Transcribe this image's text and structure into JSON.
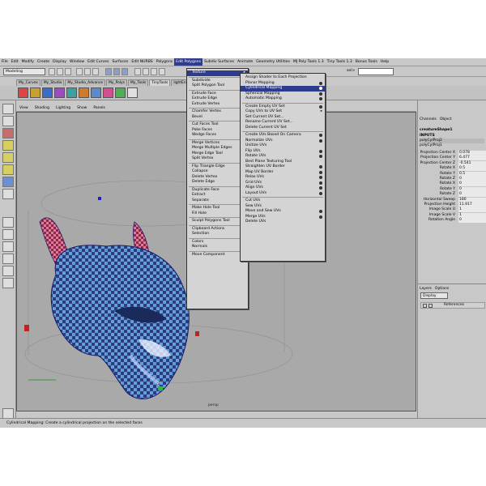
{
  "menubar": [
    "File",
    "Edit",
    "Modify",
    "Create",
    "Display",
    "Window",
    "Edit Curves",
    "Surfaces",
    "Edit NURBS",
    "Polygons",
    "Edit Polygons",
    "Subdiv Surfaces",
    "Animate",
    "Geometry Utilities",
    "MJ Poly Tools 1.3",
    "Tiny Tools 1.3",
    "Bonus Tools",
    "Help"
  ],
  "status": {
    "mode": "Modeling",
    "sel_label": "sel>"
  },
  "shelf_tabs": [
    "My_Curves",
    "My_Studio",
    "My_Studio_Advance",
    "My_Polys",
    "My_Tools",
    "TinyTools",
    "lightEnv"
  ],
  "panel_menu": [
    "View",
    "Shading",
    "Lighting",
    "Show",
    "Panels"
  ],
  "viewport": {
    "camera": "persp"
  },
  "help_line": "Cylindrical Mapping: Create a cylindrical projection on the selected faces",
  "edit_polygons_menu": {
    "items": [
      {
        "label": "Texture",
        "arrow": "▸",
        "hl": true
      },
      {
        "sep": true
      },
      {
        "label": "Subdivide",
        "opt": true
      },
      {
        "label": "Split Polygon Tool",
        "opt": true
      },
      {
        "sep": true
      },
      {
        "label": "Extrude Face",
        "opt": true
      },
      {
        "label": "Extrude Edge",
        "opt": true
      },
      {
        "label": "Extrude Vertex",
        "opt": true
      },
      {
        "sep": true
      },
      {
        "label": "Chamfer Vertex",
        "opt": true
      },
      {
        "label": "Bevel",
        "opt": true
      },
      {
        "sep": true
      },
      {
        "label": "Cut Faces Tool",
        "opt": true
      },
      {
        "label": "Poke Faces",
        "opt": true
      },
      {
        "label": "Wedge Faces",
        "opt": true
      },
      {
        "sep": true
      },
      {
        "label": "Merge Vertices",
        "opt": true
      },
      {
        "label": "Merge Multiple Edges",
        "opt": true
      },
      {
        "label": "Merge Edge Tool",
        "opt": true
      },
      {
        "label": "Split Vertex"
      },
      {
        "sep": true
      },
      {
        "label": "Flip Triangle Edge"
      },
      {
        "label": "Collapse"
      },
      {
        "label": "Delete Vertex"
      },
      {
        "label": "Delete Edge"
      },
      {
        "sep": true
      },
      {
        "label": "Duplicate Face",
        "opt": true
      },
      {
        "label": "Extract",
        "opt": true
      },
      {
        "label": "Separate"
      },
      {
        "sep": true
      },
      {
        "label": "Make Hole Tool",
        "opt": true
      },
      {
        "label": "Fill Hole"
      },
      {
        "sep": true
      },
      {
        "label": "Sculpt Polygons Tool",
        "opt": true
      },
      {
        "sep": true
      },
      {
        "label": "Clipboard Actions",
        "arrow": "▸"
      },
      {
        "label": "Selection",
        "arrow": "▸"
      },
      {
        "sep": true
      },
      {
        "label": "Colors",
        "arrow": "▸"
      },
      {
        "label": "Normals",
        "arrow": "▸"
      },
      {
        "sep": true
      },
      {
        "label": "Move Component",
        "opt": true
      }
    ]
  },
  "texture_submenu": {
    "items": [
      {
        "label": "Assign Shader to Each Projection"
      },
      {
        "label": "Planar Mapping",
        "opt": true
      },
      {
        "label": "Cylindrical Mapping",
        "opt": true,
        "hl": true
      },
      {
        "label": "Spherical Mapping",
        "opt": true
      },
      {
        "label": "Automatic Mapping",
        "opt": true
      },
      {
        "sep": true
      },
      {
        "label": "Create Empty UV Set",
        "opt": true
      },
      {
        "label": "Copy UVs to UV Set",
        "arrow": "▸"
      },
      {
        "label": "Set Current UV Set..."
      },
      {
        "label": "Rename Current UV Set..."
      },
      {
        "label": "Delete Current UV Set"
      },
      {
        "sep": true
      },
      {
        "label": "Create UVs Based On Camera",
        "opt": true
      },
      {
        "label": "Normalize UVs",
        "opt": true
      },
      {
        "label": "Unitize UVs"
      },
      {
        "label": "Flip UVs",
        "opt": true
      },
      {
        "label": "Rotate UVs",
        "opt": true
      },
      {
        "label": "Best Plane Texturing Tool"
      },
      {
        "label": "Straighten UV Border",
        "opt": true
      },
      {
        "label": "Map UV Border",
        "opt": true
      },
      {
        "label": "Relax UVs",
        "opt": true
      },
      {
        "label": "Grid UVs",
        "opt": true
      },
      {
        "label": "Align UVs",
        "opt": true
      },
      {
        "label": "Layout UVs",
        "opt": true
      },
      {
        "sep": true
      },
      {
        "label": "Cut UVs"
      },
      {
        "label": "Sew UVs"
      },
      {
        "label": "Move and Sew UVs",
        "opt": true
      },
      {
        "label": "Merge UVs",
        "opt": true
      },
      {
        "label": "Delete UVs"
      }
    ]
  },
  "channel_box": {
    "tabs": [
      "Channels",
      "Object"
    ],
    "shape": "creatureShape1",
    "inputs_label": "INPUTS",
    "nodes": [
      "polyCylProj2",
      "polyCylProj1"
    ],
    "attrs": [
      {
        "k": "Projection Center X",
        "v": "0.078"
      },
      {
        "k": "Projection Center Y",
        "v": "6.477"
      },
      {
        "k": "Projection Center Z",
        "v": "-0.541"
      },
      {
        "k": "Rotate X",
        "v": "0.5"
      },
      {
        "k": "Rotate Y",
        "v": "0.5"
      },
      {
        "k": "Rotate Z",
        "v": "0"
      },
      {
        "k": "Rotate X",
        "v": "0"
      },
      {
        "k": "Rotate Y",
        "v": "0"
      },
      {
        "k": "Rotate Z",
        "v": "0"
      },
      {
        "k": "Horizontal Sweep",
        "v": "180"
      },
      {
        "k": "Projection Height",
        "v": "11.917"
      },
      {
        "k": "Image Scale U",
        "v": "1"
      },
      {
        "k": "Image Scale V",
        "v": "1"
      },
      {
        "k": "Rotation Angle",
        "v": "0"
      }
    ]
  },
  "layers": {
    "tabs": [
      "Layers",
      "Options"
    ],
    "display": "Display",
    "layer_name": "References"
  }
}
